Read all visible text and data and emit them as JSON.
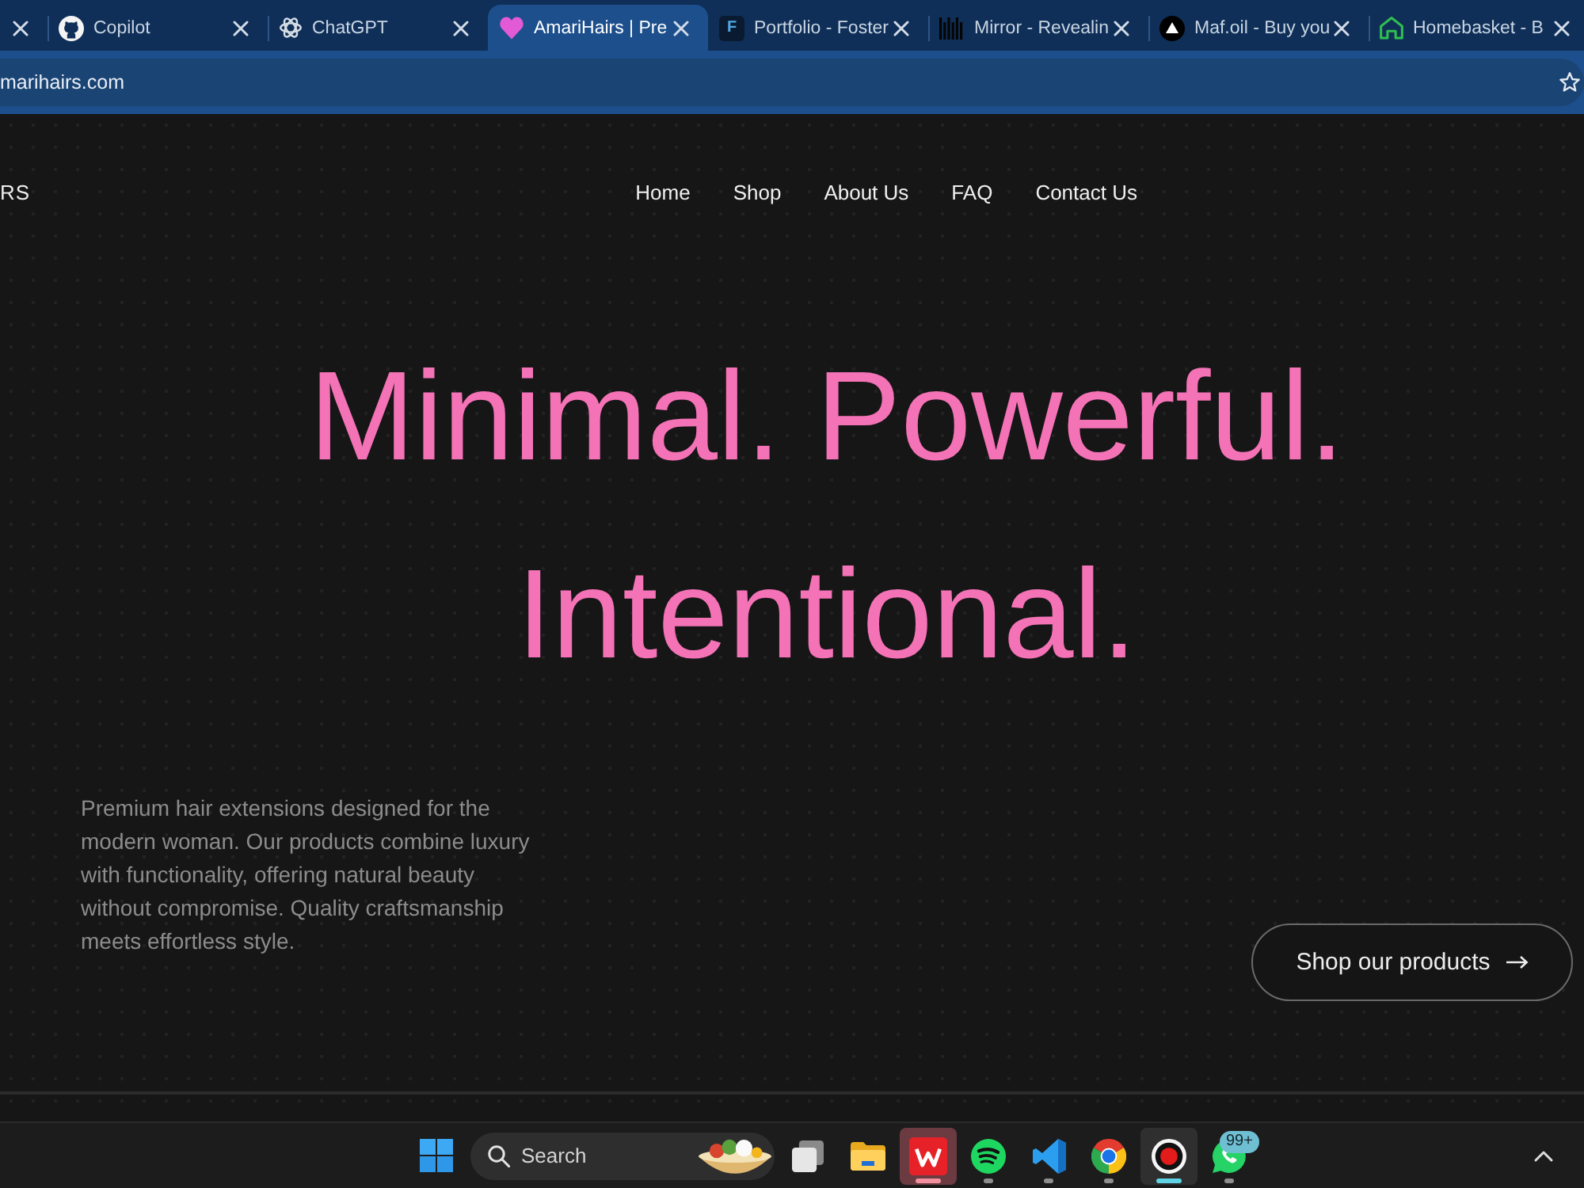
{
  "browser": {
    "tabs": [
      {
        "selected": false
      },
      {
        "title": "Copilot",
        "selected": false
      },
      {
        "title": "ChatGPT",
        "selected": false
      },
      {
        "title": "AmariHairs | Pre",
        "selected": true
      },
      {
        "title": "Portfolio - Foster",
        "icon_letter": "F",
        "selected": false
      },
      {
        "title": "Mirror - Revealin",
        "selected": false
      },
      {
        "title": "Maf.oil - Buy you",
        "selected": false
      },
      {
        "title": "Homebasket - B",
        "selected": false
      }
    ],
    "address": "marihairs.com"
  },
  "site": {
    "logo": "RS",
    "nav": [
      "Home",
      "Shop",
      "About Us",
      "FAQ",
      "Contact Us"
    ],
    "headline": [
      "Minimal. Powerful.",
      "Intentional."
    ],
    "description": "Premium hair extensions designed for the modern woman. Our products combine luxury with functionality, offering natural beauty without compromise. Quality craftsmanship meets effortless style.",
    "cta": {
      "label": "Shop our products"
    }
  },
  "taskbar": {
    "search": {
      "placeholder": "Search"
    },
    "apps": [
      {
        "running": false,
        "active": false,
        "flashing": false
      },
      {
        "running": false,
        "active": false,
        "flashing": false
      },
      {
        "running": true,
        "active": false,
        "flashing": true
      },
      {
        "running": true,
        "active": false,
        "flashing": false
      },
      {
        "running": true,
        "active": false,
        "flashing": false
      },
      {
        "running": true,
        "active": false,
        "flashing": false
      },
      {
        "running": true,
        "active": true,
        "flashing": false
      },
      {
        "running": true,
        "active": false,
        "flashing": false,
        "badge": "99+"
      }
    ]
  }
}
